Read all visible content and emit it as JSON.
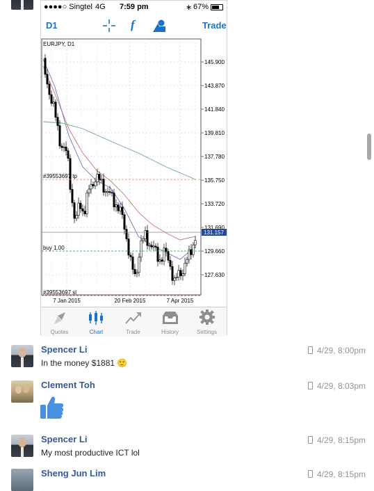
{
  "phone": {
    "status": {
      "carrier": "●●●●○ Singtel",
      "network": "4G",
      "time": "7:59 pm",
      "bluetooth": "∗",
      "battery": "67%"
    },
    "toolbar": {
      "timeframe": "D1",
      "crosshair_icon": "crosshair-icon",
      "function_label": "f",
      "objects_icon": "objects-icon",
      "trade_label": "Trade"
    },
    "chart": {
      "symbol": "EURJPY, D1",
      "price_ticks": [
        "145.900",
        "143.870",
        "141.840",
        "139.810",
        "137.780",
        "135.750",
        "133.720",
        "131.690",
        "129.660",
        "127.630"
      ],
      "current_price": "131.157",
      "date_ticks": [
        "7 Jan 2015",
        "20 Feb 2015",
        "7 Apr 2015"
      ],
      "tp_label": "#39553697 tp",
      "sl_label": "#39553697 sl",
      "order_label": "buy 1.00"
    },
    "tabs": [
      {
        "label": "Quotes",
        "icon": "quotes-icon"
      },
      {
        "label": "Chart",
        "icon": "chart-icon"
      },
      {
        "label": "Trade",
        "icon": "trade-icon"
      },
      {
        "label": "History",
        "icon": "history-icon"
      },
      {
        "label": "Settings",
        "icon": "settings-icon"
      }
    ]
  },
  "messages": [
    {
      "name": "Spencer Li",
      "text": "In the money $1881 🙂",
      "time": "4/29, 8:00pm"
    },
    {
      "name": "Clement Toh",
      "text": "",
      "time": "4/29, 8:03pm",
      "sticker": "thumbs-up"
    },
    {
      "name": "Spencer Li",
      "text": "My most productive ICT lol",
      "time": "4/29, 8:15pm"
    },
    {
      "name": "Sheng Jun Lim",
      "text": "",
      "time": "4/29, 8:15pm"
    }
  ],
  "colors": {
    "name": "#365899",
    "accent": "#1a73c9",
    "timestamp": "#90949c",
    "thumb": "#4a90e2"
  }
}
